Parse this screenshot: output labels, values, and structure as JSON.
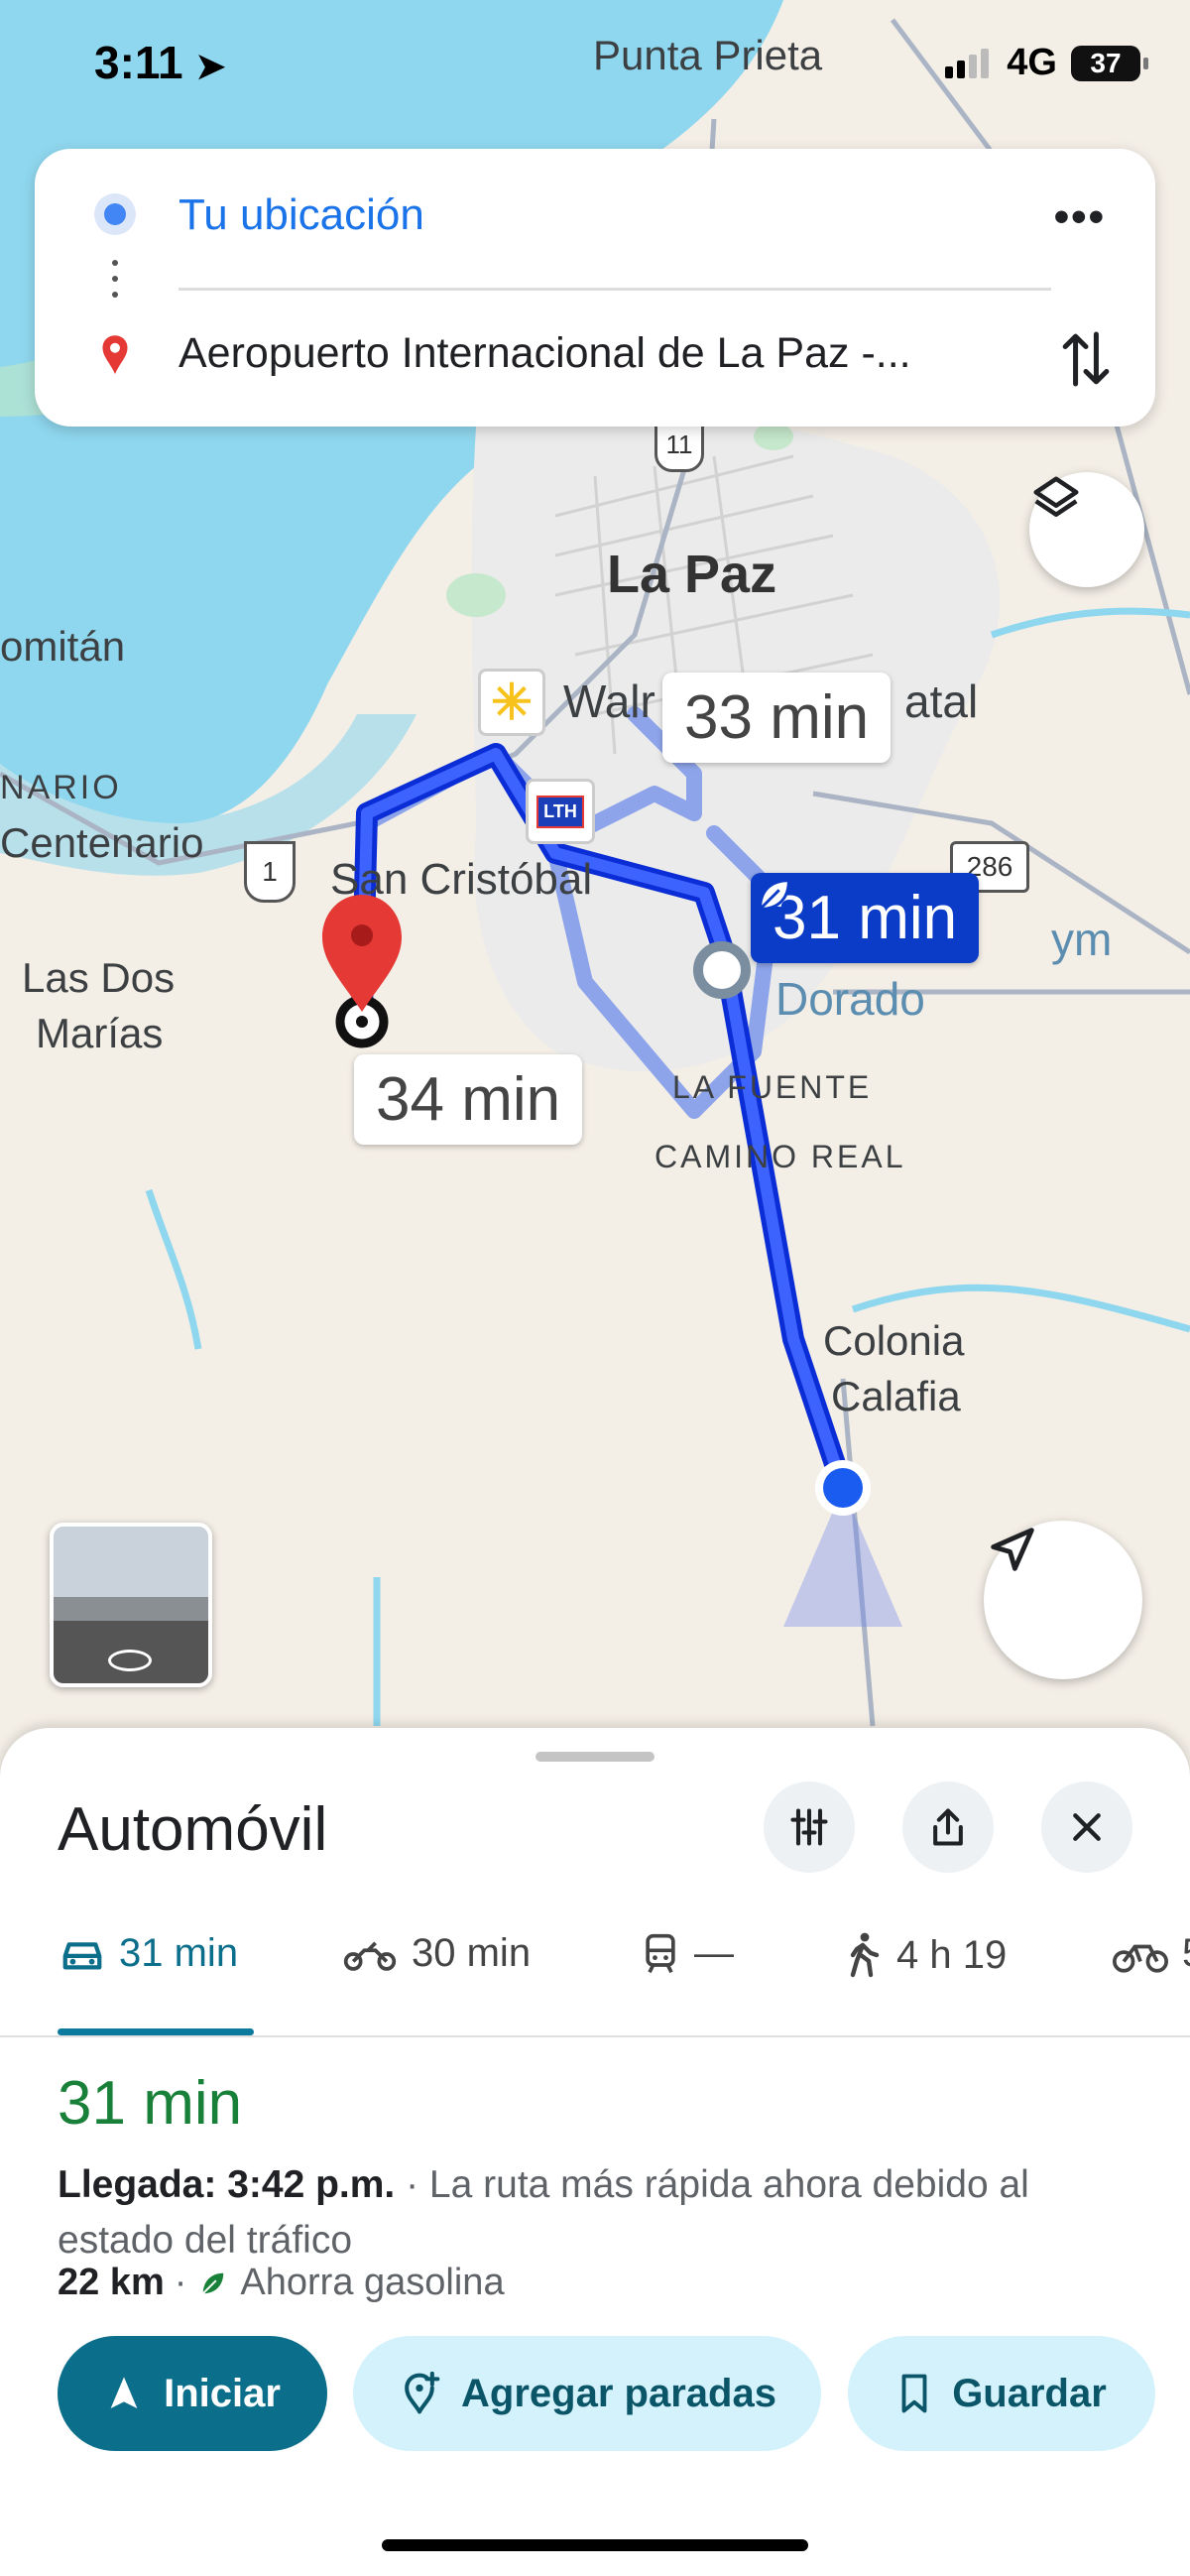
{
  "status_bar": {
    "time": "3:11",
    "network": "4G",
    "battery": "37"
  },
  "search": {
    "origin": "Tu ubicación",
    "destination": "Aeropuerto Internacional de La Paz -...",
    "more_icon": "more-horizontal-icon",
    "swap_icon": "swap-vertical-icon"
  },
  "map": {
    "labels": {
      "punta_prieta": "Punta Prieta",
      "la_paz": "La Paz",
      "comitan": "omitán",
      "walmart": "Walr",
      "atal": "atal",
      "nario": "NARIO",
      "centenario": "Centenario",
      "san_cristobal": "San Cristóbal",
      "las_dos_marias_1": "Las Dos",
      "las_dos_marias_2": "Marías",
      "ym": "ym",
      "dorado": "Dorado",
      "la_fuente": "LA FUENTE",
      "camino_real": "CAMINO REAL",
      "colonia": "Colonia",
      "calafia": "Calafia",
      "road_11": "11",
      "road_1": "1",
      "road_286": "286",
      "lth": "LTH"
    },
    "route_times": {
      "selected": "31 min",
      "alt1": "33 min",
      "alt2": "34 min"
    },
    "colors": {
      "route": "#1a3ff0",
      "alt_route": "#8da4ea",
      "water": "#8fd7ee",
      "land": "#f3eee6"
    }
  },
  "sheet": {
    "title": "Automóvil",
    "modes": [
      {
        "icon": "car-icon",
        "label": "31 min"
      },
      {
        "icon": "motorcycle-icon",
        "label": "30 min"
      },
      {
        "icon": "transit-icon",
        "label": "—"
      },
      {
        "icon": "walk-icon",
        "label": "4 h 19"
      },
      {
        "icon": "bike-icon",
        "label": "5"
      }
    ],
    "duration": "31 min",
    "arrival_label": "Llegada: 3:42 p.m.",
    "arrival_note": "· La ruta más rápida ahora debido al estado del tráfico",
    "distance": "22 km",
    "separator": "·",
    "eco": "Ahorra gasolina",
    "buttons": {
      "start": "Iniciar",
      "stops": "Agregar paradas",
      "save": "Guardar"
    }
  }
}
